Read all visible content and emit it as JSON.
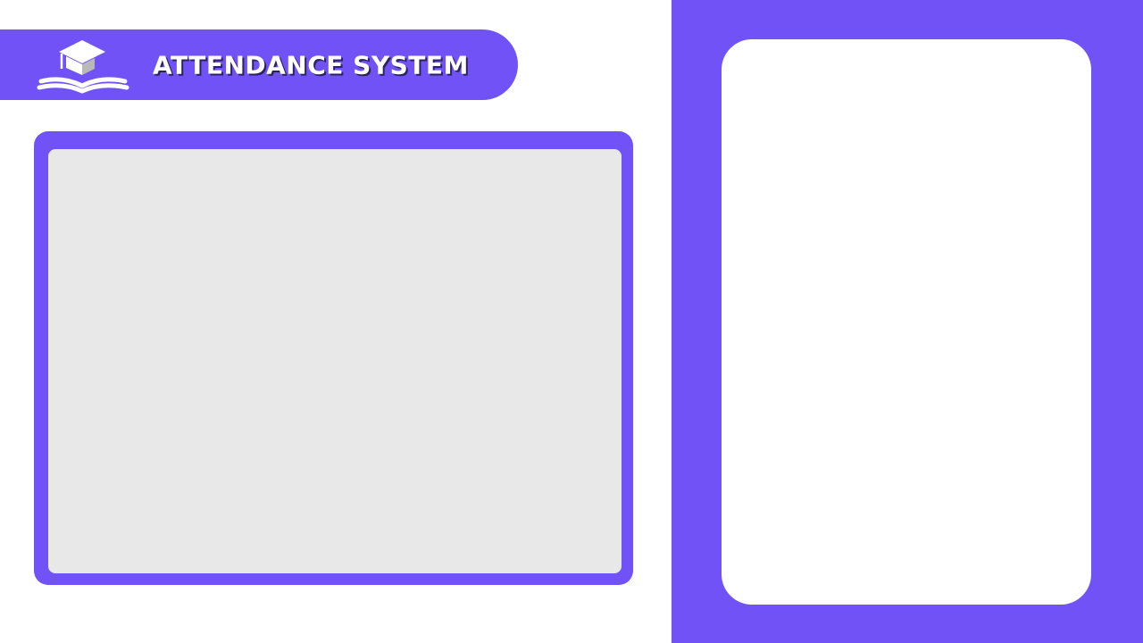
{
  "header": {
    "title": "ATTENDANCE SYSTEM",
    "logo_icon": "graduation-cap-book-icon"
  },
  "colors": {
    "accent": "#7152f7",
    "camera_background": "#e9e8e9",
    "card_background": "#ffffff",
    "title_shadow": "#2b2260"
  }
}
